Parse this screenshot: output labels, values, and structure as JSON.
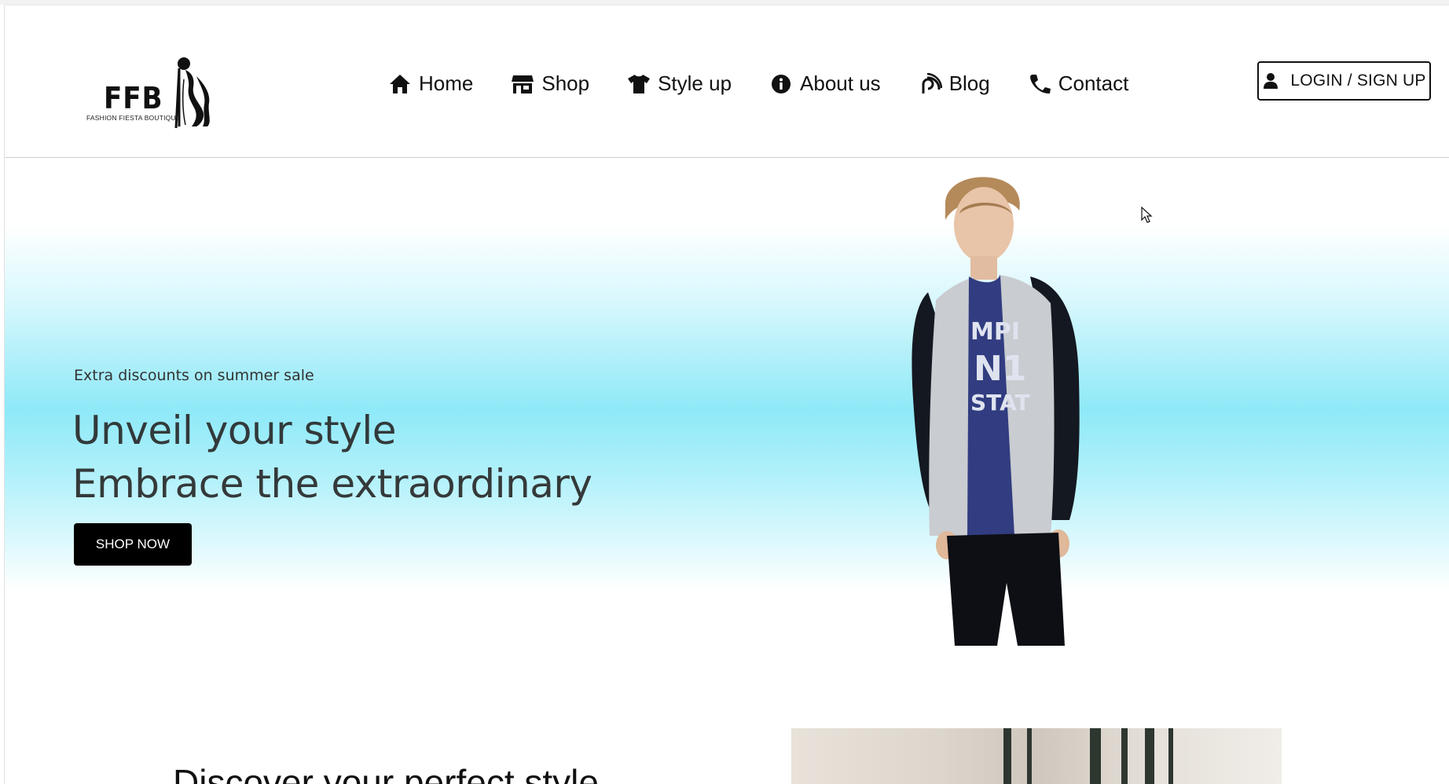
{
  "brand": {
    "name": "FFB",
    "tagline": "FASHION FIESTA BOUTIQUE"
  },
  "nav": {
    "items": [
      {
        "label": "Home",
        "icon": "home-icon"
      },
      {
        "label": "Shop",
        "icon": "store-icon"
      },
      {
        "label": "Style up",
        "icon": "tshirt-icon"
      },
      {
        "label": "About us",
        "icon": "info-icon"
      },
      {
        "label": "Blog",
        "icon": "blog-icon"
      },
      {
        "label": "Contact",
        "icon": "phone-icon"
      }
    ],
    "login_label": "LOGIN / SIGN UP"
  },
  "hero": {
    "promo": "Extra discounts on summer sale",
    "headline_line1": "Unveil your style",
    "headline_line2": "Embrace the extraordinary",
    "cta_label": "SHOP NOW"
  },
  "section": {
    "heading": "Discover your perfect style"
  },
  "colors": {
    "accent_gradient": "#8fe9f8",
    "button_bg": "#000000"
  }
}
